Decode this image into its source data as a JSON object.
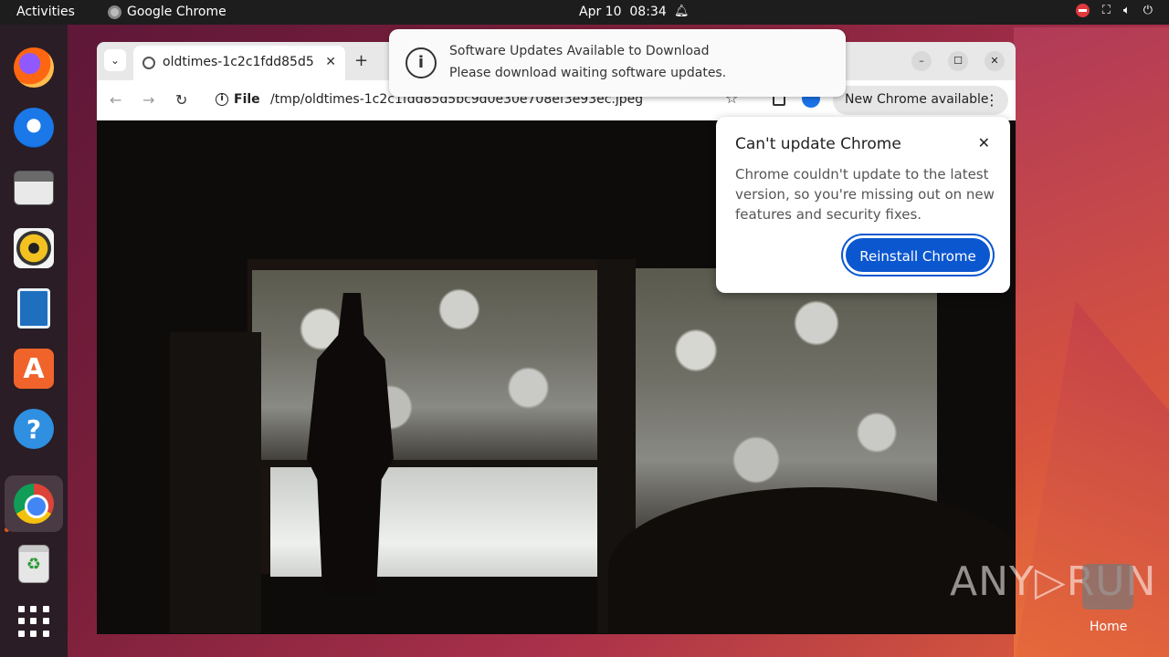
{
  "topbar": {
    "activities": "Activities",
    "app_name": "Google Chrome",
    "date": "Apr 10",
    "time": "08:34"
  },
  "dock": {
    "items": [
      "firefox-icon",
      "thunderbird-icon",
      "files-icon",
      "rhythmbox-icon",
      "writer-icon",
      "app-center-icon",
      "help-icon",
      "chrome-icon",
      "trash-icon",
      "show-apps-icon"
    ]
  },
  "browser": {
    "tab_title": "oldtimes-1c2c1fdd85d5b",
    "omnibox_scheme": "File",
    "omnibox_url": "/tmp/oldtimes-1c2c1fdd85d5bc9d0e30e708ef3e93ec.jpeg",
    "update_chip": "New Chrome available"
  },
  "notification": {
    "title": "Software Updates Available to Download",
    "body": "Please download waiting software updates."
  },
  "popup": {
    "title": "Can't update Chrome",
    "body": "Chrome couldn't update to the latest version, so you're missing out on new features and security fixes.",
    "button": "Reinstall Chrome"
  },
  "desktop": {
    "watermark": "ANY▷RUN",
    "home_label": "Home"
  },
  "colors": {
    "accent": "#0b57d0",
    "topbar": "#1d1d1d",
    "dock": "#2a1d25"
  }
}
